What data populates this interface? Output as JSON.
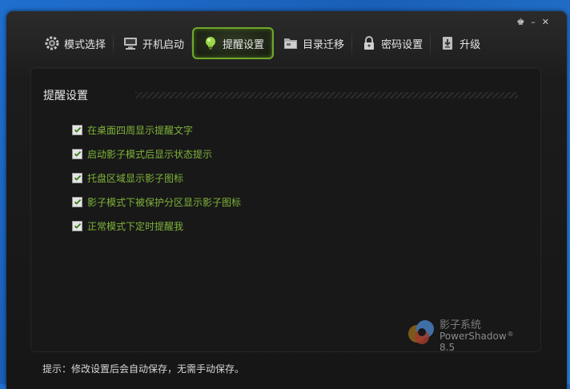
{
  "window_controls": {
    "shirt": "♚",
    "minimize": "–",
    "close": "✕"
  },
  "tabs": [
    {
      "label": "模式选择",
      "icon": "gear-icon"
    },
    {
      "label": "开机启动",
      "icon": "monitor-icon"
    },
    {
      "label": "提醒设置",
      "icon": "lightbulb-icon",
      "active": true
    },
    {
      "label": "目录迁移",
      "icon": "folder-icon"
    },
    {
      "label": "密码设置",
      "icon": "lock-icon"
    },
    {
      "label": "升级",
      "icon": "download-icon"
    }
  ],
  "panel": {
    "title": "提醒设置",
    "options": [
      {
        "label": "在桌面四周显示提醒文字",
        "checked": true
      },
      {
        "label": "启动影子模式后显示状态提示",
        "checked": true
      },
      {
        "label": "托盘区域显示影子图标",
        "checked": true
      },
      {
        "label": "影子模式下被保护分区显示影子图标",
        "checked": true
      },
      {
        "label": "正常模式下定时提醒我",
        "checked": true
      }
    ]
  },
  "logo": {
    "name_cn": "影子系统",
    "name_en": "PowerShadow",
    "reg": "®",
    "version": "8.5"
  },
  "hint": "提示：修改设置后会自动保存，无需手动保存。",
  "colors": {
    "accent": "#7fb33a",
    "active_border": "#6ea82a"
  }
}
